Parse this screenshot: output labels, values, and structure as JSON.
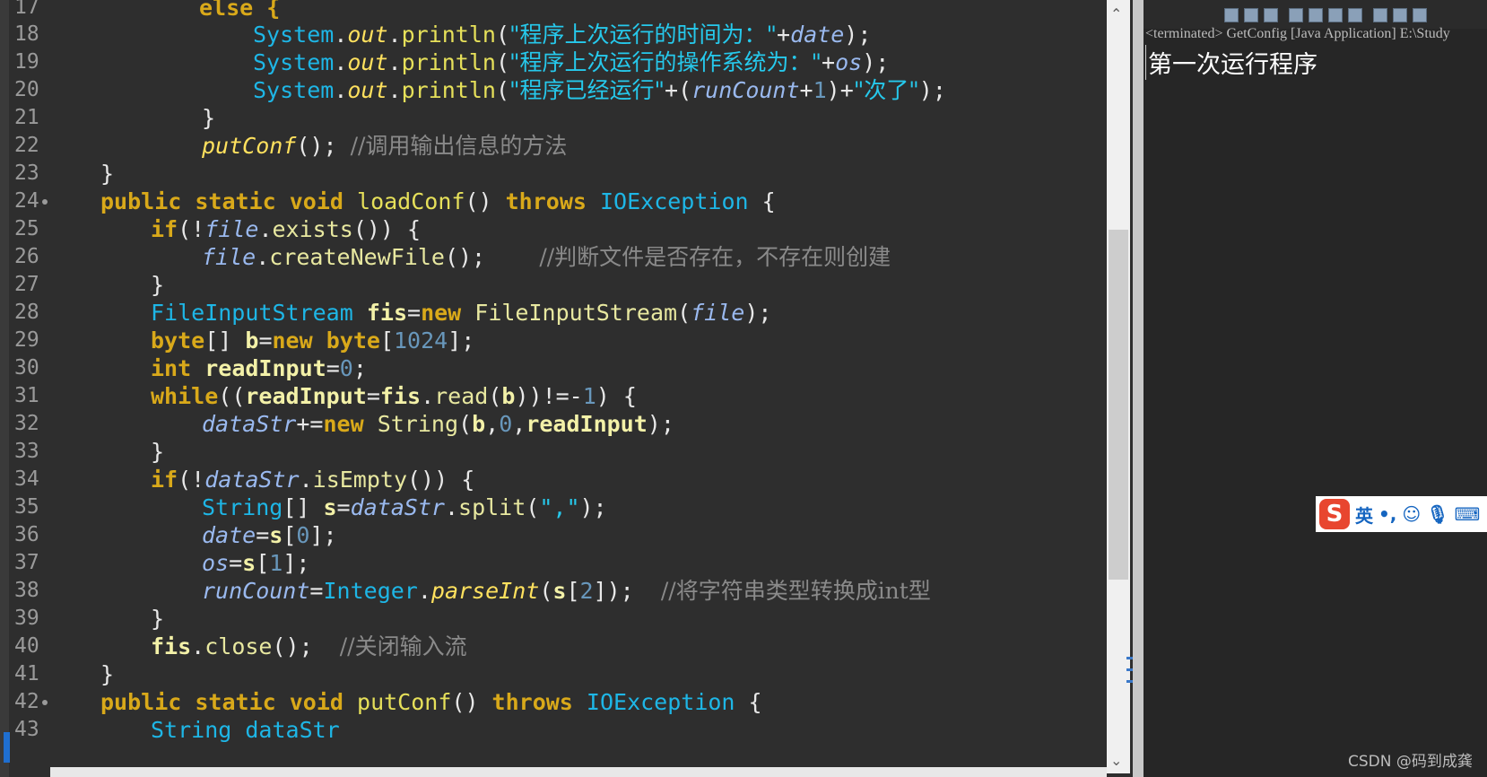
{
  "editor": {
    "line_numbers": [
      "17",
      "18",
      "19",
      "20",
      "21",
      "22",
      "23",
      "24",
      "25",
      "26",
      "27",
      "28",
      "29",
      "30",
      "31",
      "32",
      "33",
      "34",
      "35",
      "36",
      "37",
      "38",
      "39",
      "40",
      "41",
      "42",
      "43"
    ],
    "code": {
      "l17_else": "else {",
      "l18_a": "System",
      "l18_b": "out",
      "l18_c": "println",
      "l18_str": "\"程序上次运行的时间为：\"",
      "l18_var": "date",
      "l19_str": "\"程序上次运行的操作系统为：\"",
      "l19_var": "os",
      "l20_str1": "\"程序已经运行\"",
      "l20_var": "runCount",
      "l20_num": "1",
      "l20_str2": "\"次了\"",
      "l22_call": "putConf",
      "l22_cm": "//调用输出信息的方法",
      "kw_public": "public",
      "kw_static": "static",
      "kw_void": "void",
      "l24_fn": "loadConf",
      "kw_throws": "throws",
      "ty_ioexception": "IOException",
      "kw_if": "if",
      "fld_file": "file",
      "l25_exists": "exists",
      "l26_create": "createNewFile",
      "l26_cm": "//判断文件是否存在，不存在则创建",
      "ty_fis": "FileInputStream",
      "var_fis": "fis",
      "kw_new": "new",
      "kw_byte": "byte",
      "var_b": "b",
      "num_1024": "1024",
      "kw_int": "int",
      "var_readinput": "readInput",
      "num_0": "0",
      "kw_while": "while",
      "l31_read": "read",
      "num_1": "1",
      "fld_datastr": "dataStr",
      "ty_string": "String",
      "l34_isempty": "isEmpty",
      "var_s": "s",
      "l35_split": "split",
      "l35_str": "\",\"",
      "fld_date": "date",
      "fld_os": "os",
      "fld_runcount": "runCount",
      "ty_integer": "Integer",
      "l38_parse": "parseInt",
      "num_2": "2",
      "l38_cm": "//将字符串类型转换成int型",
      "l40_close": "close",
      "l40_cm": "//关闭输入流",
      "l42_fn": "putConf",
      "l43_partial": "String dataStr"
    }
  },
  "console": {
    "status": "<terminated> GetConfig [Java Application] E:\\Study",
    "output": "第一次运行程序"
  },
  "ime": {
    "logo": "S",
    "mode": "英",
    "punct": "•,"
  },
  "watermark": "CSDN @码到成龚",
  "icons": [
    "stop-icon",
    "remove-icon",
    "remove-all-icon",
    "scroll-lock-icon",
    "pin-console-icon",
    "display-console-icon",
    "open-console-icon",
    "minimize-icon"
  ]
}
